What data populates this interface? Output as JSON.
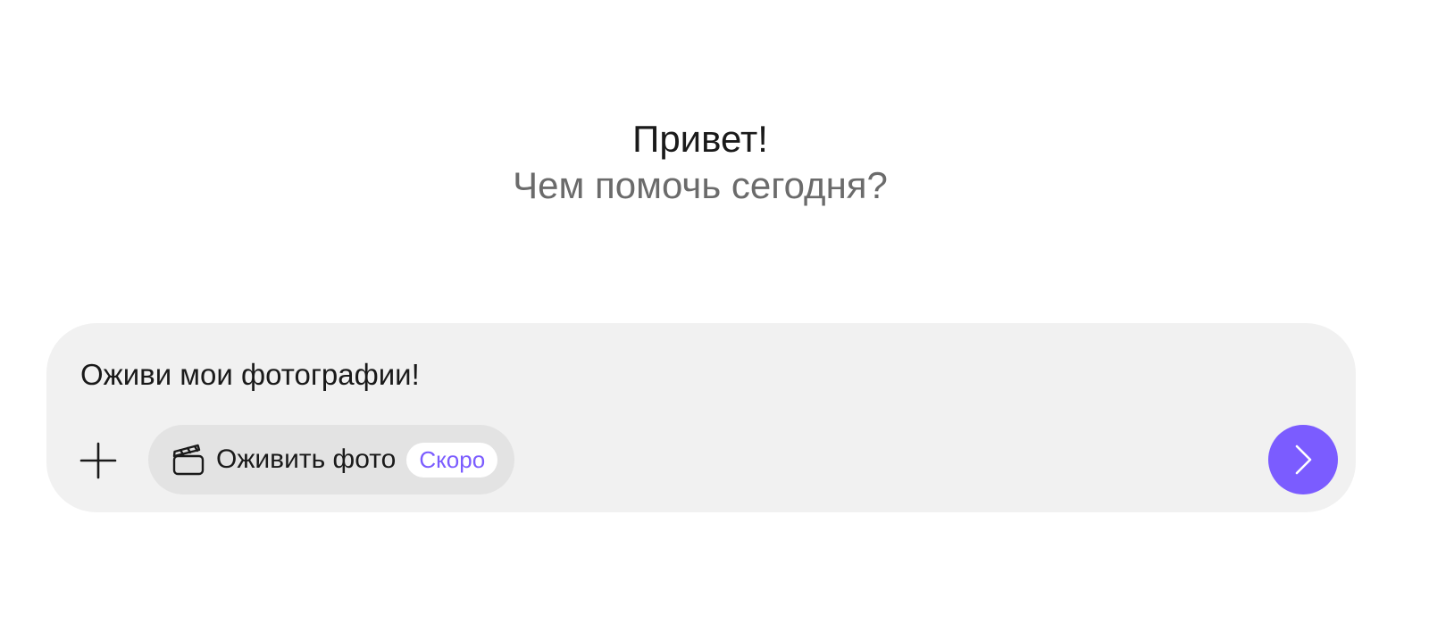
{
  "greeting": {
    "title": "Привет!",
    "subtitle": "Чем помочь сегодня?"
  },
  "composer": {
    "input_value": "Оживи мои фотографии!",
    "add_icon": "plus-icon",
    "chip": {
      "icon": "clapperboard-icon",
      "label": "Оживить фото",
      "badge": "Скоро"
    },
    "send_icon": "chevron-right-icon"
  },
  "colors": {
    "accent": "#7b5cff",
    "composer_bg": "#f1f1f1",
    "chip_bg": "#e3e3e3",
    "subtitle": "#6b6b6b"
  }
}
